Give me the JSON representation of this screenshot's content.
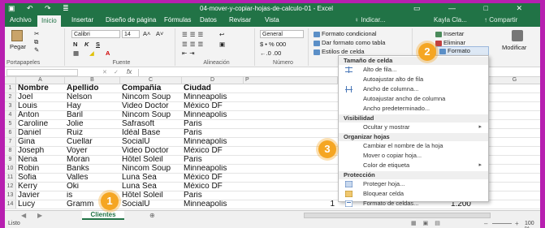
{
  "window": {
    "title": "04-mover-y-copiar-hojas-de-calculo-01 - Excel",
    "quick_access": "▣ ↶ ↷ ≣",
    "controls": "▭ — □ ✕"
  },
  "tabs": {
    "items": [
      "Archivo",
      "Inicio",
      "Insertar",
      "Diseño de página",
      "Fórmulas",
      "Datos",
      "Revisar",
      "Vista"
    ],
    "search": "♀ Indicar...",
    "user": "Kayla Cla...",
    "share": "↑ Compartir"
  },
  "ribbon": {
    "paste_label": "Pegar",
    "font_name": "Calibri",
    "font_size": "14",
    "bold": "N",
    "italic": "K",
    "underline": "S",
    "grow": "A˄",
    "shrink": "A˅",
    "number_format": "General",
    "number_buttons": "$ • % 000",
    "decimals": "←.0 .00",
    "cond_format": "Formato condicional",
    "table_format": "Dar formato como tabla",
    "cell_styles": "Estilos de celda",
    "insert": "Insertar",
    "delete": "Eliminar",
    "format": "Formato",
    "modify": "Modificar",
    "groups": [
      "Portapapeles",
      "Fuente",
      "Alineación",
      "Número",
      "Es"
    ]
  },
  "formula_bar": {
    "fx": "fx",
    "cancel": "✕",
    "accept": "✓"
  },
  "columns": [
    "A",
    "B",
    "C",
    "D",
    "G"
  ],
  "column_e_stub": "P",
  "rows": [
    {
      "n": "1",
      "a": "Nombre",
      "b": "Apellido",
      "c": "Compañía",
      "d": "Ciudad",
      "e": "",
      "bold": true
    },
    {
      "n": "2",
      "a": "Joel",
      "b": "Nelson",
      "c": "Nincom Soup",
      "d": "Minneapolis",
      "e": ""
    },
    {
      "n": "3",
      "a": "Louis",
      "b": "Hay",
      "c": "Video Doctor",
      "d": "México DF",
      "e": ""
    },
    {
      "n": "4",
      "a": "Anton",
      "b": "Baril",
      "c": "Nincom Soup",
      "d": "Minneapolis",
      "e": ""
    },
    {
      "n": "5",
      "a": "Caroline",
      "b": "Jolie",
      "c": "Safrasoft",
      "d": "Paris",
      "e": ""
    },
    {
      "n": "6",
      "a": "Daniel",
      "b": "Ruiz",
      "c": "Idéal Base",
      "d": "Paris",
      "e": ""
    },
    {
      "n": "7",
      "a": "Gina",
      "b": "Cuellar",
      "c": "SocialU",
      "d": "Minneapolis",
      "e": ""
    },
    {
      "n": "8",
      "a": "Joseph",
      "b": "Voyer",
      "c": "Video Doctor",
      "d": "México DF",
      "e": ""
    },
    {
      "n": "9",
      "a": "Nena",
      "b": "Moran",
      "c": "Hôtel Soleil",
      "d": "Paris",
      "e": ""
    },
    {
      "n": "10",
      "a": "Robin",
      "b": "Banks",
      "c": "Nincom Soup",
      "d": "Minneapolis",
      "e": ""
    },
    {
      "n": "11",
      "a": "Sofia",
      "b": "Valles",
      "c": "Luna Sea",
      "d": "México DF",
      "e": ""
    },
    {
      "n": "12",
      "a": "Kerry",
      "b": "Oki",
      "c": "Luna Sea",
      "d": "México DF",
      "e": ""
    },
    {
      "n": "13",
      "a": "Javier",
      "b": "is",
      "c": "Hôtel Soleil",
      "d": "Paris",
      "e": "",
      "f": "3.551"
    },
    {
      "n": "14",
      "a": "Lucy",
      "b": "Gramm",
      "c": "SocialU",
      "d": "Minneapolis",
      "e": "1",
      "f": "1.200"
    }
  ],
  "sheet_tab": "Clientes",
  "add_sheet": "⊕",
  "status": {
    "left": "Listo",
    "zoom": "100 %"
  },
  "menu": {
    "header_size": "Tamaño de celda",
    "row_height": "Alto de fila...",
    "autofit_row": "Autoajustar alto de fila",
    "col_width": "Ancho de columna...",
    "autofit_col": "Autoajustar ancho de columna",
    "default_width": "Ancho predeterminado...",
    "header_visibility": "Visibilidad",
    "hide_show": "Ocultar y mostrar",
    "header_organize": "Organizar hojas",
    "rename_sheet": "Cambiar el nombre de la hoja",
    "move_copy": "Mover o copiar hoja...",
    "tab_color": "Color de etiqueta",
    "header_protection": "Protección",
    "protect_sheet": "Proteger hoja...",
    "lock_cell": "Bloquear celda",
    "format_cells": "Formato de celdas...",
    "arrow": "▸"
  },
  "badges": [
    "1",
    "2",
    "3"
  ],
  "colors": {
    "excel_green": "#217346",
    "badge_orange": "#f5a623",
    "background_magenta": "#b71fb0"
  }
}
